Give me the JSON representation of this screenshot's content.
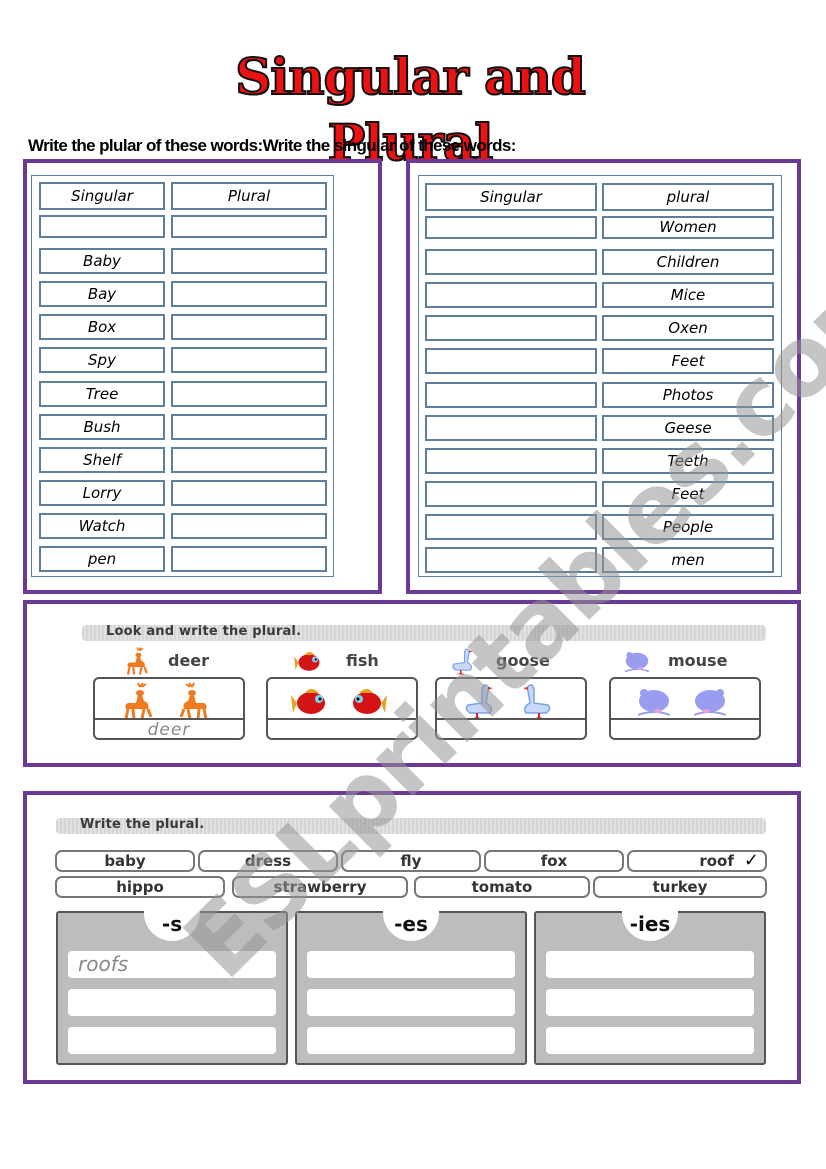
{
  "title": "Singular and Plural",
  "instruction": "Write the plular of these words:Write the singular of these words:",
  "left_table": {
    "headers": [
      "Singular",
      "Plural"
    ],
    "rows": [
      {
        "singular": "",
        "plural": ""
      },
      {
        "singular": "Baby",
        "plural": ""
      },
      {
        "singular": "Bay",
        "plural": ""
      },
      {
        "singular": "Box",
        "plural": ""
      },
      {
        "singular": "Spy",
        "plural": ""
      },
      {
        "singular": "Tree",
        "plural": ""
      },
      {
        "singular": "Bush",
        "plural": ""
      },
      {
        "singular": "Shelf",
        "plural": ""
      },
      {
        "singular": "Lorry",
        "plural": ""
      },
      {
        "singular": "Watch",
        "plural": ""
      },
      {
        "singular": "pen",
        "plural": ""
      }
    ]
  },
  "right_table": {
    "headers": [
      "Singular",
      "plural"
    ],
    "rows": [
      {
        "singular": "",
        "plural": "Women"
      },
      {
        "singular": "",
        "plural": "Children"
      },
      {
        "singular": "",
        "plural": "Mice"
      },
      {
        "singular": "",
        "plural": "Oxen"
      },
      {
        "singular": "",
        "plural": "Feet"
      },
      {
        "singular": "",
        "plural": "Photos"
      },
      {
        "singular": "",
        "plural": "Geese"
      },
      {
        "singular": "",
        "plural": "Teeth"
      },
      {
        "singular": "",
        "plural": "Feet"
      },
      {
        "singular": "",
        "plural": "People"
      },
      {
        "singular": "",
        "plural": "men"
      }
    ]
  },
  "look_section": {
    "heading": "Look and write the plural.",
    "items": [
      {
        "word": "deer",
        "icon": "deer-icon",
        "answer": "deer",
        "color": "#f07a20"
      },
      {
        "word": "fish",
        "icon": "fish-icon",
        "answer": "",
        "color": "#d41414"
      },
      {
        "word": "goose",
        "icon": "goose-icon",
        "answer": "",
        "color": "#7aa2e8"
      },
      {
        "word": "mouse",
        "icon": "mouse-icon",
        "answer": "",
        "color": "#9a9cf0"
      }
    ]
  },
  "write_section": {
    "heading": "Write the plural.",
    "words_row1": [
      "baby",
      "dress",
      "fly",
      "fox",
      "roof"
    ],
    "words_row2": [
      "hippo",
      "strawberry",
      "tomato",
      "turkey"
    ],
    "checked_word": "roof",
    "check_mark": "✓",
    "columns": [
      {
        "suffix": "-s",
        "answers": [
          "roofs",
          "",
          ""
        ]
      },
      {
        "suffix": "-es",
        "answers": [
          "",
          "",
          ""
        ]
      },
      {
        "suffix": "-ies",
        "answers": [
          "",
          "",
          ""
        ]
      }
    ]
  },
  "watermark": "ESLprintables.com",
  "colors": {
    "frame": "#6a3a96",
    "title": "#ee1111",
    "cell_border": "#5d7f9d"
  }
}
